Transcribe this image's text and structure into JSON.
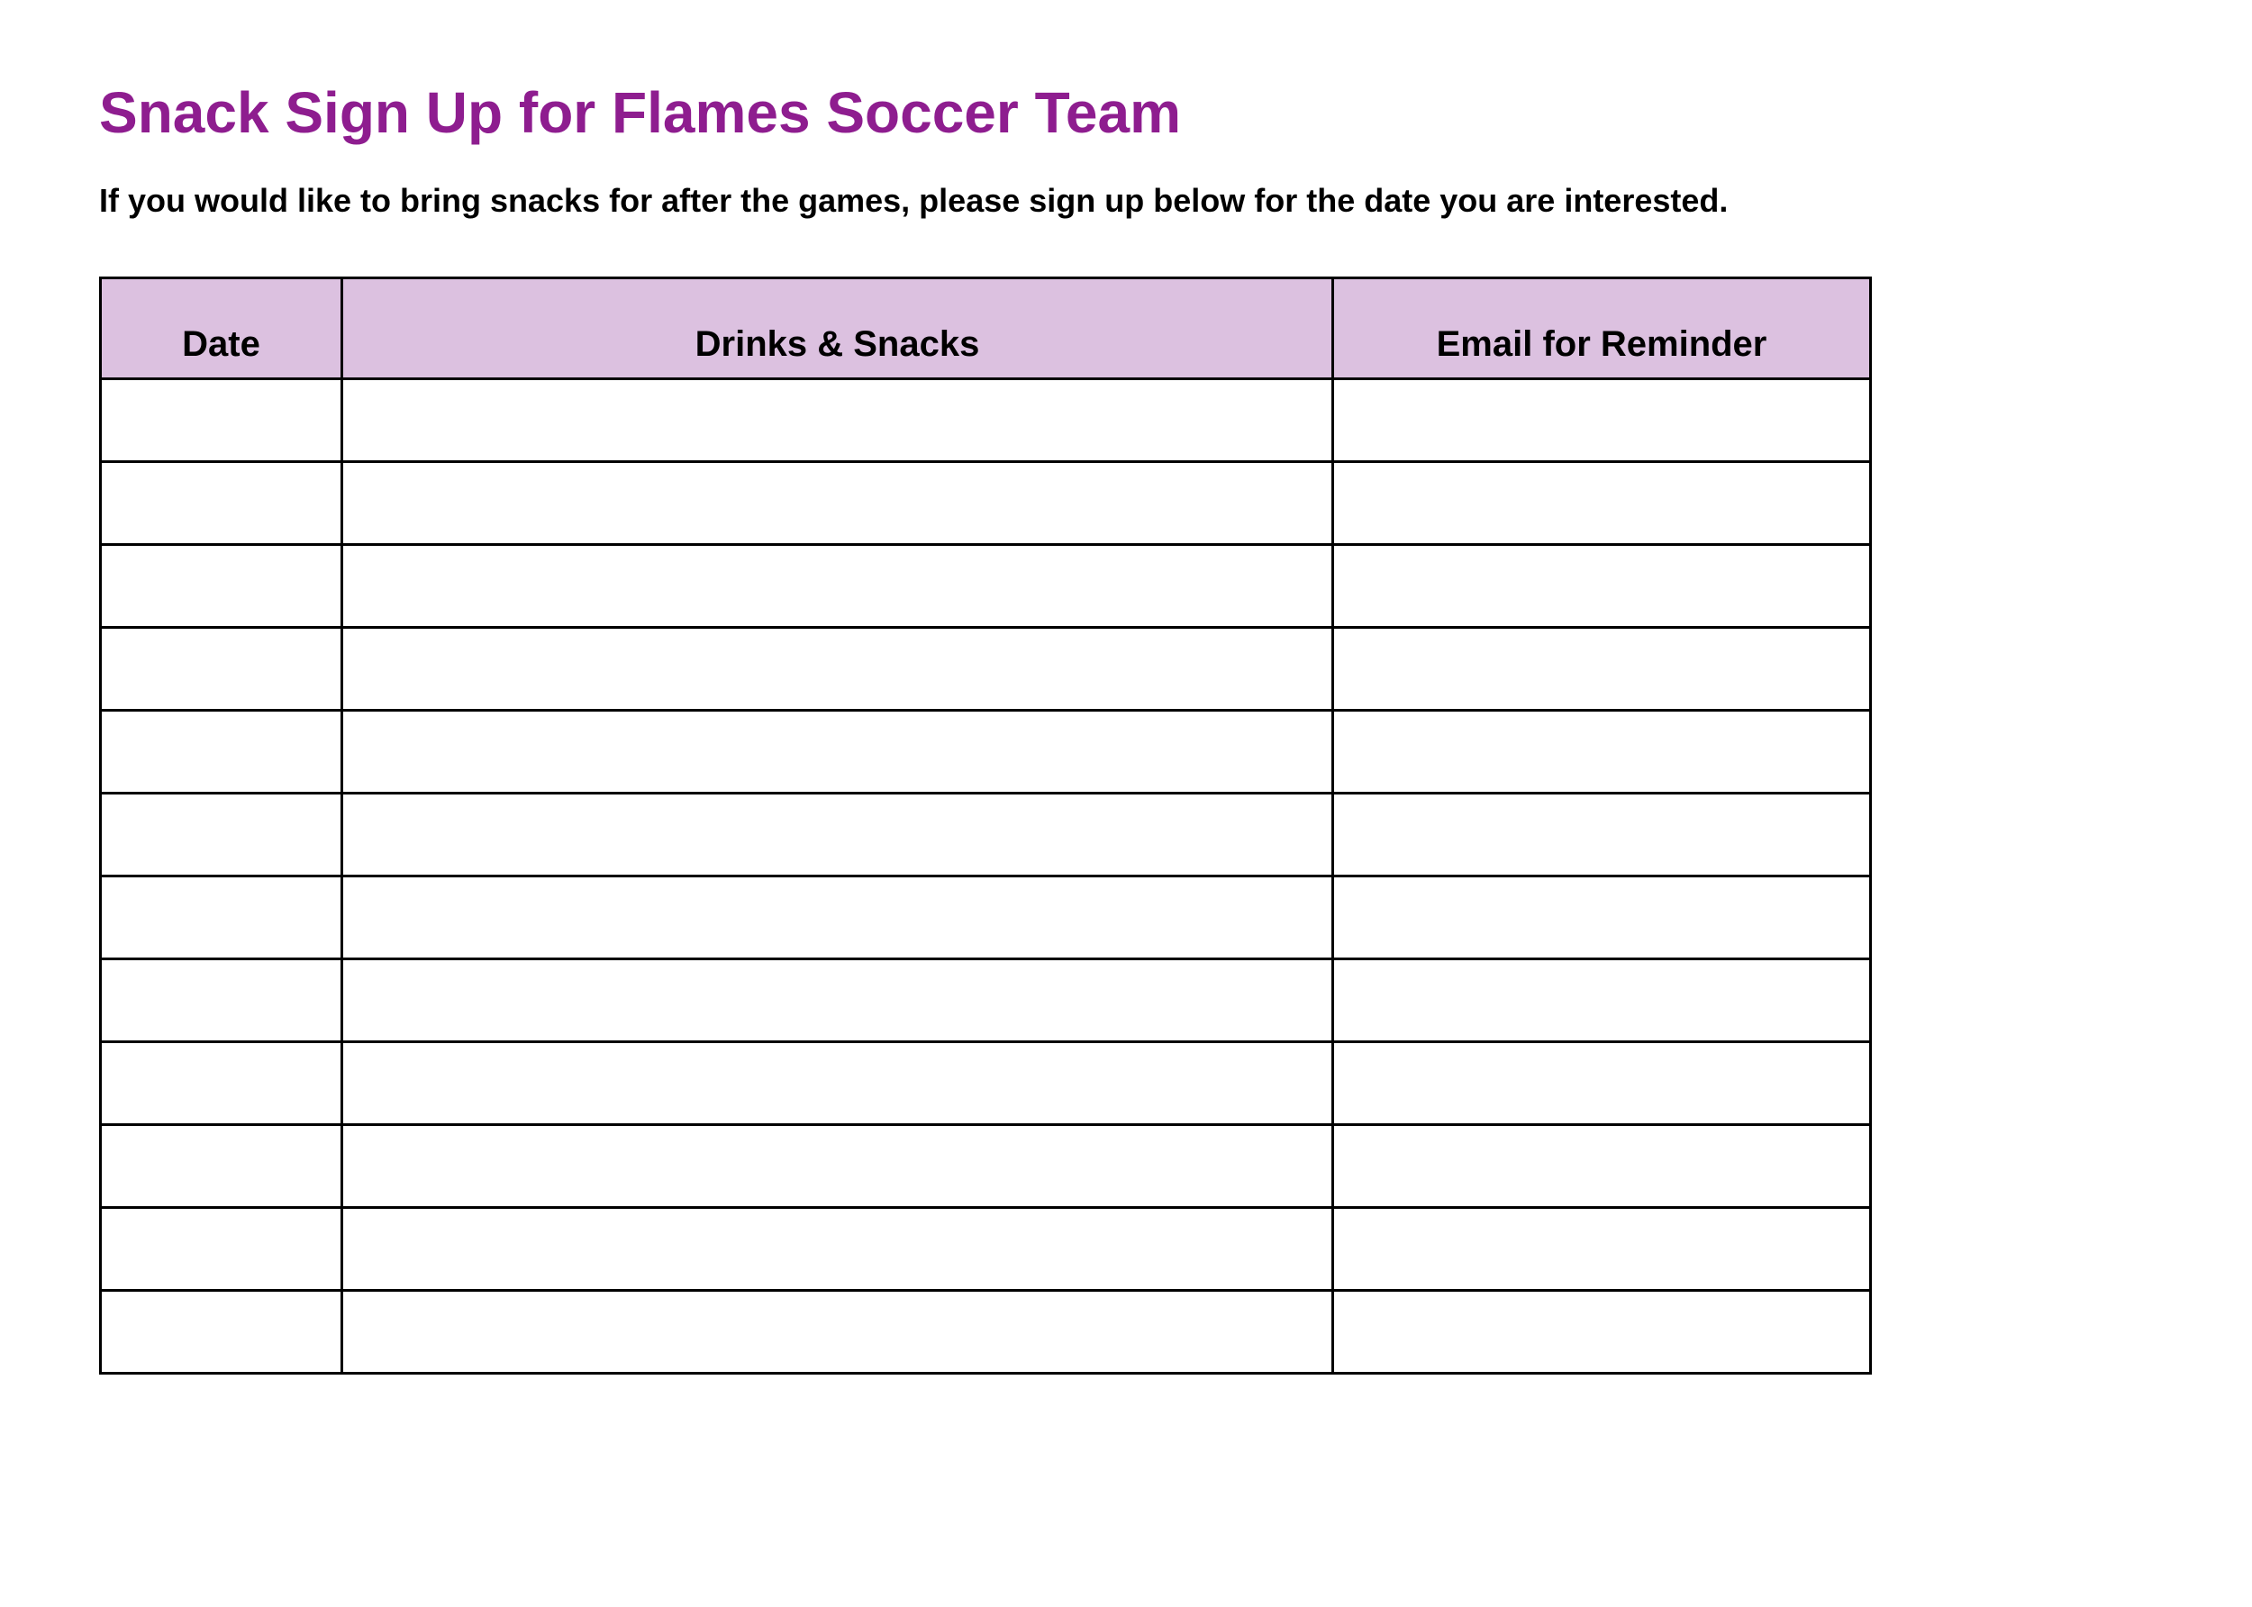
{
  "title": "Snack Sign Up for Flames Soccer Team",
  "subtitle": "If you would like to bring snacks for after the games, please sign up below for the date you are interested.",
  "table": {
    "headers": {
      "date": "Date",
      "snacks": "Drinks & Snacks",
      "email": "Email for Reminder"
    },
    "rows": [
      {
        "date": "",
        "snacks": "",
        "email": ""
      },
      {
        "date": "",
        "snacks": "",
        "email": ""
      },
      {
        "date": "",
        "snacks": "",
        "email": ""
      },
      {
        "date": "",
        "snacks": "",
        "email": ""
      },
      {
        "date": "",
        "snacks": "",
        "email": ""
      },
      {
        "date": "",
        "snacks": "",
        "email": ""
      },
      {
        "date": "",
        "snacks": "",
        "email": ""
      },
      {
        "date": "",
        "snacks": "",
        "email": ""
      },
      {
        "date": "",
        "snacks": "",
        "email": ""
      },
      {
        "date": "",
        "snacks": "",
        "email": ""
      },
      {
        "date": "",
        "snacks": "",
        "email": ""
      },
      {
        "date": "",
        "snacks": "",
        "email": ""
      }
    ]
  },
  "colors": {
    "title": "#8e1d8f",
    "header_bg": "#dcc1e0"
  }
}
